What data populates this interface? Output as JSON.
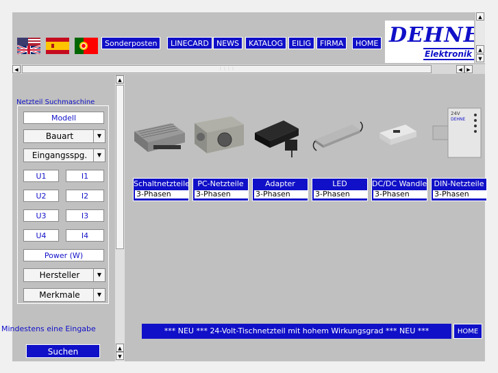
{
  "flags": [
    {
      "name": "uk-us-flag-icon"
    },
    {
      "name": "spain-flag-icon"
    },
    {
      "name": "portugal-flag-icon"
    }
  ],
  "nav": [
    "Sonderposten",
    "LINECARD",
    "NEWS",
    "KATALOG",
    "EILIG",
    "FIRMA",
    "HOME"
  ],
  "logo": {
    "main": "DEHNE",
    "sub": "Elektronik Gr"
  },
  "left": {
    "title": "Netzteil Suchmaschine",
    "modell": "Modell",
    "bauart": "Bauart",
    "eingang": "Eingangsspg.",
    "u1": "U1",
    "i1": "I1",
    "u2": "U2",
    "i2": "I2",
    "u3": "U3",
    "i3": "I3",
    "u4": "U4",
    "i4": "I4",
    "power": "Power (W)",
    "hersteller": "Hersteller",
    "merkmale": "Merkmale",
    "mindestens": "Mindestens eine Eingabe",
    "suchen": "Suchen"
  },
  "products": [
    {
      "cat": "Schaltnetzteile",
      "sub": "3-Phasen"
    },
    {
      "cat": "PC-Netzteile",
      "sub": "3-Phasen"
    },
    {
      "cat": "Adapter",
      "sub": "3-Phasen"
    },
    {
      "cat": "LED",
      "sub": "3-Phasen"
    },
    {
      "cat": "DC/DC Wandler",
      "sub": "3-Phasen"
    },
    {
      "cat": "DIN-Netzteile",
      "sub": "3-Phasen"
    }
  ],
  "ticker": "*** NEU ***   24-Volt-Tischnetzteil mit hohem Wirkungsgrad   *** NEU ***",
  "home_small": "HOME",
  "colors": {
    "accent": "#1010c8",
    "panel": "#c0c0c0"
  }
}
